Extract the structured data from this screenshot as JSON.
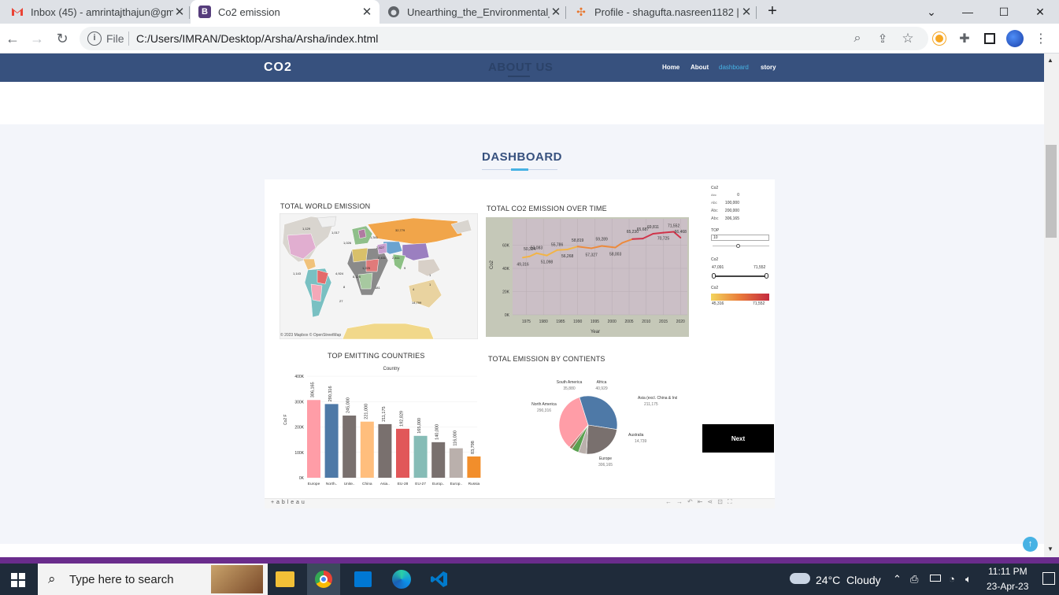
{
  "browser": {
    "tabs": [
      {
        "title": "Inbox (45) - amrintajthajun@gma",
        "icon": "gmail-icon",
        "active": false
      },
      {
        "title": "Co2 emission",
        "icon": "bootstrap-icon",
        "active": true
      },
      {
        "title": "Unearthing_the_Environmental_Im",
        "icon": "github-icon",
        "active": false
      },
      {
        "title": "Profile - shagufta.nasreen1182 | T",
        "icon": "tableau-icon",
        "active": false
      }
    ],
    "new_tab": "+",
    "address_label": "File",
    "address": "C:/Users/IMRAN/Desktop/Arsha/Arsha/index.html"
  },
  "site": {
    "logo": "CO2",
    "ghost_heading": "ABOUT US",
    "nav": [
      "Home",
      "About",
      "dashboard",
      "story"
    ],
    "active_nav": "dashboard",
    "accent": "#47b2e4",
    "nav_bg": "#37517e",
    "section_title": "DASHBOARD"
  },
  "dashboard": {
    "map": {
      "title": "TOTAL WORLD EMISSION",
      "credit": "© 2023 Mapbox © OpenStreetMap",
      "labels": [
        "32,779",
        "1,129",
        "1,017",
        "1,026",
        "2,427",
        "2,431",
        "2,411",
        "1,341",
        "9",
        "8",
        "4",
        "14,799",
        "4,924",
        "8,125",
        "1,225",
        "1,143",
        "181",
        "27",
        "1",
        "1"
      ]
    },
    "line_chart": {
      "title": "TOTAL CO2 EMISSION OVER TIME",
      "ylabel": "Co2",
      "xlabel": "Year",
      "yticks": [
        "0K",
        "20K",
        "40K",
        "60K"
      ],
      "xticks": [
        "1975",
        "1980",
        "1985",
        "1990",
        "1995",
        "2000",
        "2005",
        "2010",
        "2015",
        "2020"
      ],
      "point_labels": [
        "50,324",
        "49,316",
        "53,083",
        "55,786",
        "51,098",
        "56,268",
        "58,819",
        "57,327",
        "59,289",
        "58,003",
        "65,230",
        "69,811",
        "65,687",
        "70,725",
        "71,552",
        "66,468"
      ]
    },
    "filters": {
      "co2_legend_title": "Co2",
      "co2_legend": [
        {
          "key": "Abc",
          "value": "0"
        },
        {
          "key": "Abc",
          "value": "100,000"
        },
        {
          "key": "Abc",
          "value": "200,000"
        },
        {
          "key": "Abc",
          "value": "306,165"
        }
      ],
      "top_label": "TOP",
      "top_value": "10",
      "range_label": "Co2",
      "range_min": "47,091",
      "range_max": "71,552",
      "color_label": "Co2",
      "color_min": "45,316",
      "color_max": "71,552"
    },
    "bar_chart": {
      "title": "TOP EMITTING COUNTRIES",
      "subtitle": "Country",
      "ylabel": "Co2 F",
      "yticks": [
        "0K",
        "100K",
        "200K",
        "300K",
        "400K"
      ]
    },
    "pie": {
      "title": "TOTAL EMISSION BY CONTIENTS",
      "labels": [
        {
          "name": "South America",
          "value": "35,880"
        },
        {
          "name": "Africa",
          "value": "40,929"
        },
        {
          "name": "Asia (excl. China & India)",
          "value": "211,175"
        },
        {
          "name": "North America",
          "value": "290,316"
        },
        {
          "name": "Australia",
          "value": "14,739"
        },
        {
          "name": "Europe",
          "value": "306,165"
        }
      ]
    },
    "next_button": "Next",
    "footer_brand": "+ a b l e a u"
  },
  "chart_data": [
    {
      "type": "bar",
      "title": "TOP EMITTING COUNTRIES",
      "xlabel": "",
      "ylabel": "Co2 F",
      "ylim": [
        0,
        400000
      ],
      "categories": [
        "Europe",
        "North..",
        "Unite..",
        "China",
        "Asia..",
        "EU-28",
        "EU-27",
        "Europ..",
        "Europ..",
        "Russia"
      ],
      "values": [
        306165,
        290316,
        245000,
        221000,
        211175,
        192829,
        165000,
        140000,
        116000,
        83798
      ],
      "value_labels": [
        "306,165",
        "290,316",
        "245,000",
        "221,000",
        "211,175",
        "192,829",
        "165,000",
        "140,000",
        "116,000",
        "83,798"
      ],
      "colors": [
        "#ff9da7",
        "#4e79a7",
        "#79706e",
        "#ffbe7d",
        "#79706e",
        "#e15759",
        "#86bcb6",
        "#79706e",
        "#bab0ac",
        "#f28e2b"
      ]
    },
    {
      "type": "line",
      "title": "TOTAL CO2 EMISSION OVER TIME",
      "xlabel": "Year",
      "ylabel": "Co2",
      "ylim": [
        0,
        80000
      ],
      "x": [
        1974,
        1976,
        1978,
        1981,
        1984,
        1987,
        1990,
        1994,
        1997,
        2001,
        2003,
        2006,
        2009,
        2012,
        2015,
        2018,
        2020
      ],
      "values": [
        49316,
        50324,
        53083,
        51098,
        55786,
        56268,
        58819,
        57327,
        59289,
        58003,
        62000,
        65230,
        65687,
        69811,
        70725,
        71552,
        66468
      ]
    },
    {
      "type": "pie",
      "title": "TOTAL EMISSION BY CONTIENTS",
      "categories": [
        "Europe",
        "North America",
        "Asia (excl. China & India)",
        "Africa",
        "South America",
        "Australia"
      ],
      "values": [
        306165,
        290316,
        211175,
        40929,
        35880,
        14739
      ],
      "colors": [
        "#ff9da7",
        "#4e79a7",
        "#79706e",
        "#bab0ac",
        "#59a14f",
        "#9c755f"
      ]
    }
  ],
  "taskbar": {
    "search_placeholder": "Type here to search",
    "weather": "24°C  Cloudy",
    "time": "11:11 PM",
    "date": "23-Apr-23"
  }
}
